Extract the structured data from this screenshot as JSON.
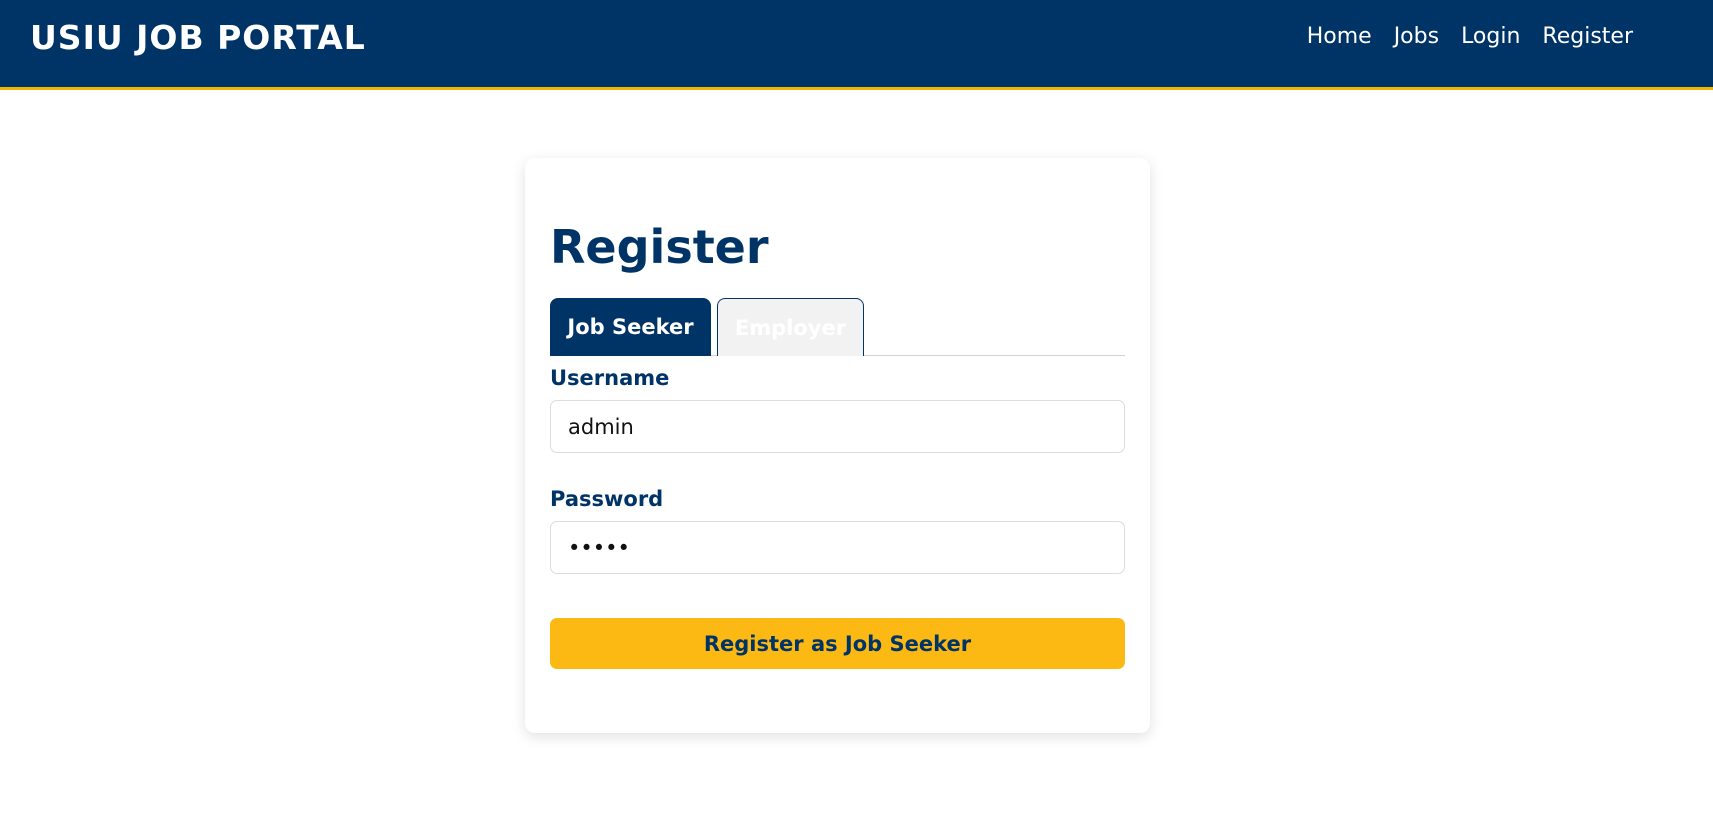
{
  "header": {
    "brand": "USIU JOB PORTAL",
    "nav": [
      {
        "label": "Home"
      },
      {
        "label": "Jobs"
      },
      {
        "label": "Login"
      },
      {
        "label": "Register"
      }
    ]
  },
  "register": {
    "title": "Register",
    "tabs": [
      {
        "label": "Job Seeker",
        "active": true
      },
      {
        "label": "Employer",
        "active": false
      }
    ],
    "username": {
      "label": "Username",
      "value": "admin"
    },
    "password": {
      "label": "Password",
      "value": "admin"
    },
    "submit_label": "Register as Job Seeker"
  },
  "colors": {
    "primary": "#003366",
    "accent": "#fdb913",
    "background": "#ffffff"
  }
}
